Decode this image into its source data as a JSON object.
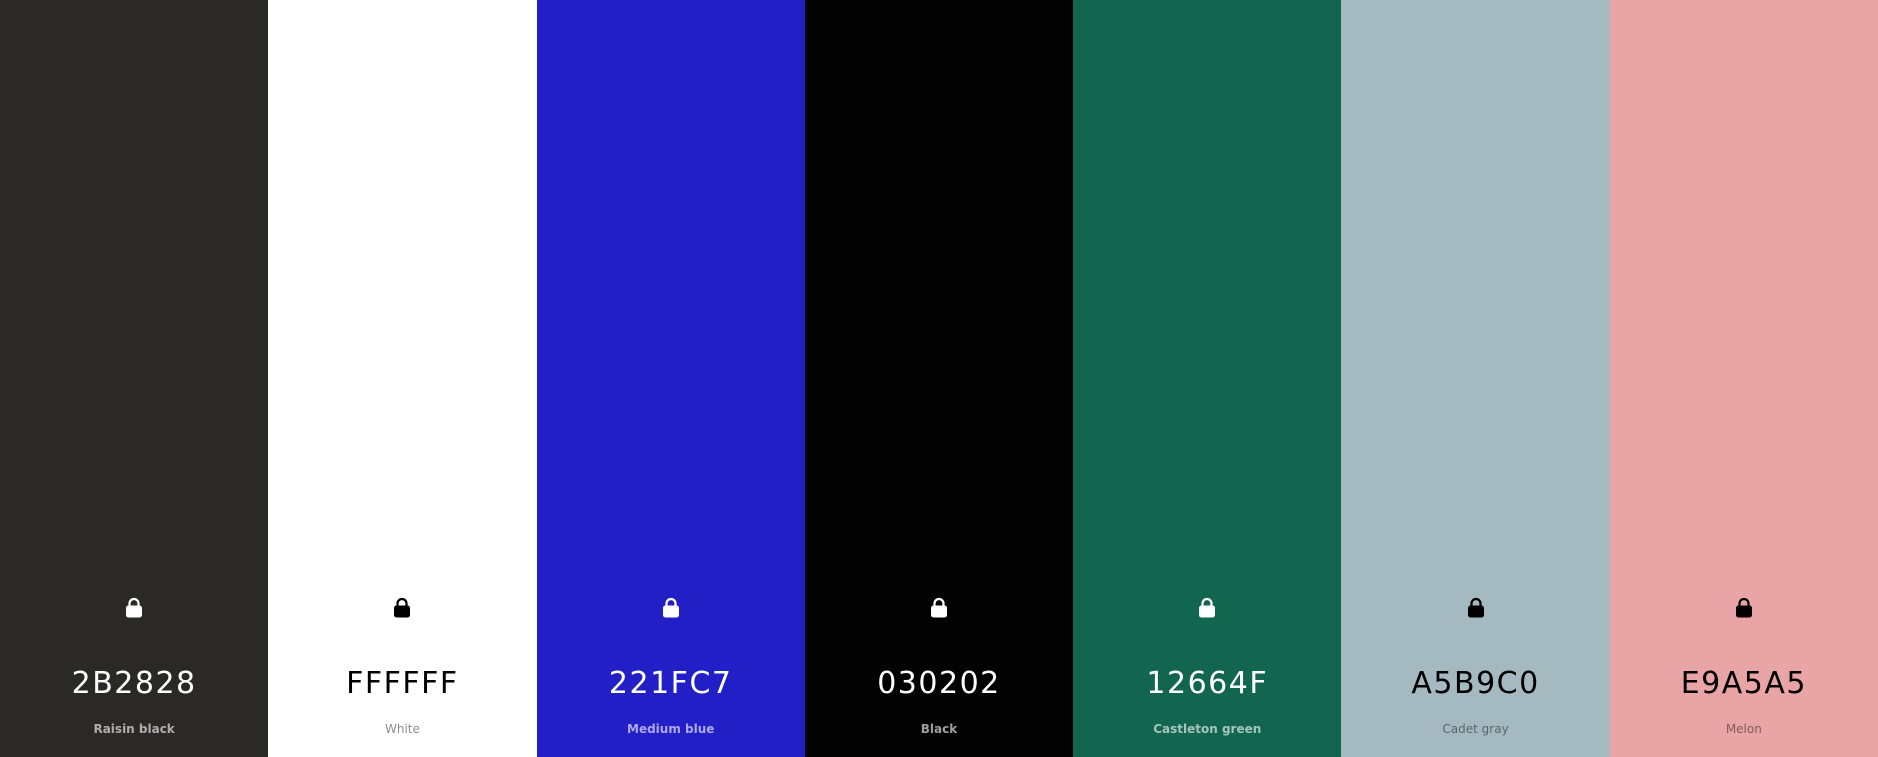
{
  "palette": {
    "swatches": [
      {
        "hex": "2B2828",
        "name": "Raisin black",
        "color": "#2B2828",
        "text_color": "#FFFFFF",
        "lock_icon": "lock-icon"
      },
      {
        "hex": "FFFFFF",
        "name": "White",
        "color": "#FFFFFF",
        "text_color": "#000000",
        "lock_icon": "lock-icon"
      },
      {
        "hex": "221FC7",
        "name": "Medium blue",
        "color": "#221FC7",
        "text_color": "#FFFFFF",
        "lock_icon": "lock-icon"
      },
      {
        "hex": "030202",
        "name": "Black",
        "color": "#030202",
        "text_color": "#FFFFFF",
        "lock_icon": "lock-icon"
      },
      {
        "hex": "12664F",
        "name": "Castleton green",
        "color": "#12664F",
        "text_color": "#FFFFFF",
        "lock_icon": "lock-icon"
      },
      {
        "hex": "A5B9C0",
        "name": "Cadet gray",
        "color": "#A5B9C0",
        "text_color": "#000000",
        "lock_icon": "lock-icon"
      },
      {
        "hex": "E9A5A5",
        "name": "Melon",
        "color": "#E9A5A5",
        "text_color": "#000000",
        "lock_icon": "lock-icon"
      }
    ]
  }
}
